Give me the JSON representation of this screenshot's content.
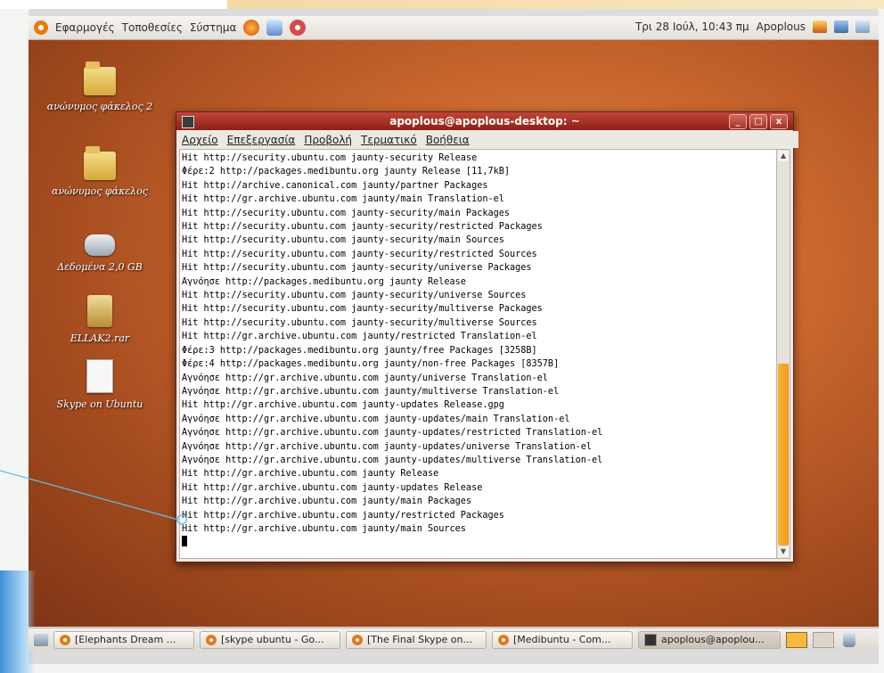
{
  "top_panel": {
    "menus": [
      "Εφαρμογές",
      "Τοποθεσίες",
      "Σύστημα"
    ],
    "clock": "Τρι 28 Ιούλ, 10:43 πμ",
    "user": "Apoplous"
  },
  "desktop": {
    "icons": [
      {
        "label": "ανώνυμος φάκελος 2",
        "icon": "folder-icon"
      },
      {
        "label": "ανώνυμος φάκελος",
        "icon": "folder-icon"
      },
      {
        "label": "Δεδομένα 2,0 GB",
        "icon": "drive-icon"
      },
      {
        "label": "ELLAK2.rar",
        "icon": "archive-icon"
      },
      {
        "label": "Skype on Ubuntu",
        "icon": "text-file-icon"
      }
    ]
  },
  "terminal": {
    "title": "apoplous@apoplous-desktop: ~",
    "menu": [
      "Αρχείο",
      "Επεξεργασία",
      "Προβολή",
      "Τερματικό",
      "Βοήθεια"
    ],
    "buttons": {
      "minimize": "_",
      "maximize": "□",
      "close": "x"
    },
    "lines": [
      "Hit http://security.ubuntu.com jaunty-security Release",
      "Φέρε:2 http://packages.medibuntu.org jaunty Release [11,7kB]",
      "Hit http://archive.canonical.com jaunty/partner Packages",
      "Hit http://gr.archive.ubuntu.com jaunty/main Translation-el",
      "Hit http://security.ubuntu.com jaunty-security/main Packages",
      "Hit http://security.ubuntu.com jaunty-security/restricted Packages",
      "Hit http://security.ubuntu.com jaunty-security/main Sources",
      "Hit http://security.ubuntu.com jaunty-security/restricted Sources",
      "Hit http://security.ubuntu.com jaunty-security/universe Packages",
      "Αγνόησε http://packages.medibuntu.org jaunty Release",
      "Hit http://security.ubuntu.com jaunty-security/universe Sources",
      "Hit http://security.ubuntu.com jaunty-security/multiverse Packages",
      "Hit http://security.ubuntu.com jaunty-security/multiverse Sources",
      "Hit http://gr.archive.ubuntu.com jaunty/restricted Translation-el",
      "Φέρε:3 http://packages.medibuntu.org jaunty/free Packages [3258B]",
      "Φέρε:4 http://packages.medibuntu.org jaunty/non-free Packages [8357B]",
      "Αγνόησε http://gr.archive.ubuntu.com jaunty/universe Translation-el",
      "Αγνόησε http://gr.archive.ubuntu.com jaunty/multiverse Translation-el",
      "Hit http://gr.archive.ubuntu.com jaunty-updates Release.gpg",
      "Αγνόησε http://gr.archive.ubuntu.com jaunty-updates/main Translation-el",
      "Αγνόησε http://gr.archive.ubuntu.com jaunty-updates/restricted Translation-el",
      "Αγνόησε http://gr.archive.ubuntu.com jaunty-updates/universe Translation-el",
      "Αγνόησε http://gr.archive.ubuntu.com jaunty-updates/multiverse Translation-el",
      "Hit http://gr.archive.ubuntu.com jaunty Release",
      "Hit http://gr.archive.ubuntu.com jaunty-updates Release",
      "Hit http://gr.archive.ubuntu.com jaunty/main Packages",
      "Hit http://gr.archive.ubuntu.com jaunty/restricted Packages",
      "Hit http://gr.archive.ubuntu.com jaunty/main Sources"
    ]
  },
  "taskbar": {
    "tasks": [
      {
        "label": "[Elephants Dream ...",
        "icon": "firefox-icon"
      },
      {
        "label": "[skype ubuntu - Go...",
        "icon": "firefox-icon"
      },
      {
        "label": "[The Final Skype on...",
        "icon": "firefox-icon"
      },
      {
        "label": "[Medibuntu - Com...",
        "icon": "firefox-icon"
      },
      {
        "label": "apoplous@apoplou...",
        "icon": "terminal-icon"
      }
    ]
  },
  "colors": {
    "titlebar": "#a8342a",
    "scroll_thumb": "#f2a01e",
    "desktop": "#c9672e",
    "callout_line": "#5fc0e8"
  }
}
